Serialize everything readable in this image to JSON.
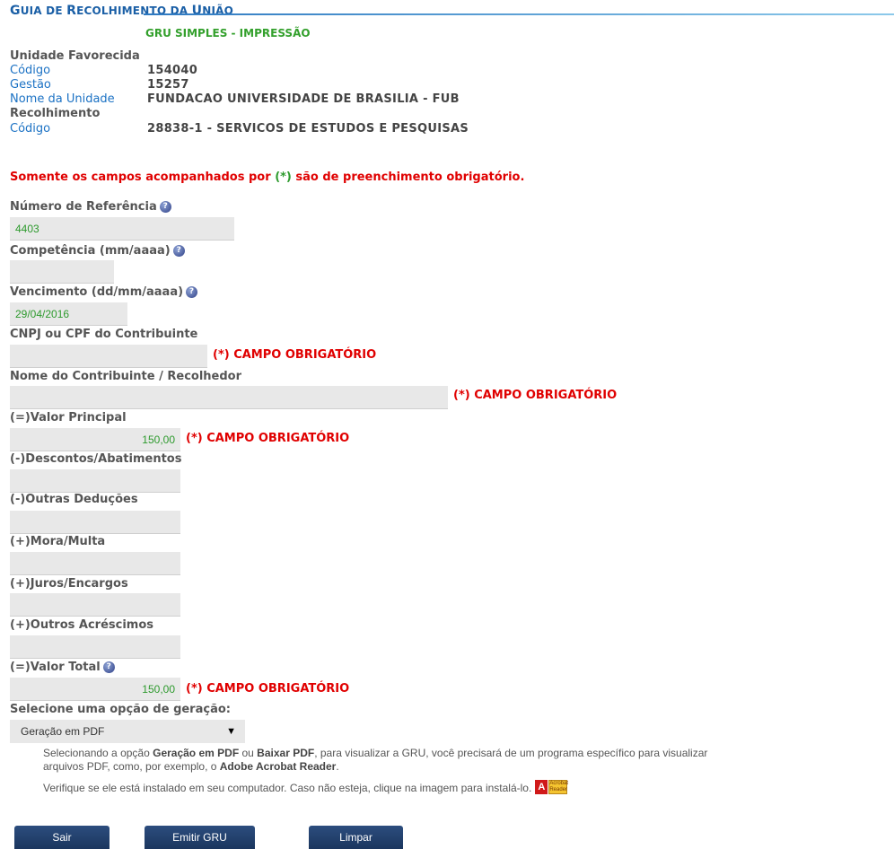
{
  "header": {
    "title_part1": "G",
    "title_part2": "UIA DE ",
    "title_part3": "R",
    "title_part4": "ECOLHIMENTO DA ",
    "title_part5": "U",
    "title_part6": "NIÃO",
    "subtitle": "GRU SIMPLES - IMPRESSÃO"
  },
  "unidade": {
    "heading": "Unidade Favorecida",
    "codigo_label": "Código",
    "codigo_value": "154040",
    "gestao_label": "Gestão",
    "gestao_value": "15257",
    "nome_label": "Nome da Unidade",
    "nome_value": "FUNDACAO UNIVERSIDADE DE BRASILIA - FUB"
  },
  "recolhimento": {
    "heading": "Recolhimento",
    "codigo_label": "Código",
    "codigo_value": "28838-1 - SERVICOS DE ESTUDOS E PESQUISAS"
  },
  "notice": {
    "part1": "Somente os campos acompanhados por ",
    "marker": "(*)",
    "part2": " são de preenchimento obrigatório."
  },
  "help_icon": "question-help-icon",
  "required_text": "(*) CAMPO OBRIGATÓRIO",
  "fields": {
    "referencia": {
      "label": "Número de Referência",
      "value": "4403"
    },
    "competencia": {
      "label": "Competência (mm/aaaa)",
      "value": ""
    },
    "vencimento": {
      "label": "Vencimento (dd/mm/aaaa)",
      "value": "29/04/2016"
    },
    "cnpj": {
      "label": "CNPJ ou CPF do Contribuinte",
      "value": ""
    },
    "nome": {
      "label": "Nome do Contribuinte / Recolhedor",
      "value": ""
    },
    "valor_principal": {
      "label": "(=)Valor Principal",
      "value": "150,00"
    },
    "descontos": {
      "label": "(-)Descontos/Abatimentos",
      "value": ""
    },
    "deducoes": {
      "label": "(-)Outras Deduções",
      "value": ""
    },
    "mora": {
      "label": "(+)Mora/Multa",
      "value": ""
    },
    "juros": {
      "label": "(+)Juros/Encargos",
      "value": ""
    },
    "acrescimos": {
      "label": "(+)Outros Acréscimos",
      "value": ""
    },
    "valor_total": {
      "label": "(=)Valor Total",
      "value": "150,00"
    }
  },
  "geracao": {
    "label": "Selecione uma opção de geração:",
    "selected": "Geração em PDF"
  },
  "info": {
    "l1a": "Selecionando a opção ",
    "l1b": "Geração em PDF",
    "l1c": " ou ",
    "l1d": "Baixar PDF",
    "l1e": ", para visualizar a GRU, você precisará de um programa específico para visualizar",
    "l2a": "arquivos PDF, como, por exemplo, o ",
    "l2b": "Adobe Acrobat Reader",
    "l2c": ".",
    "l3": "Verifique se ele está instalado em seu computador. Caso não esteja, clique na imagem para instalá-lo.",
    "adobe_icon": "adobe-reader-icon"
  },
  "buttons": {
    "sair": "Sair",
    "emitir": "Emitir GRU",
    "limpar": "Limpar"
  },
  "colors": {
    "title_blue": "#1a5fa6",
    "green": "#2d9a2d",
    "red": "#e00000",
    "button": "#23416e"
  }
}
